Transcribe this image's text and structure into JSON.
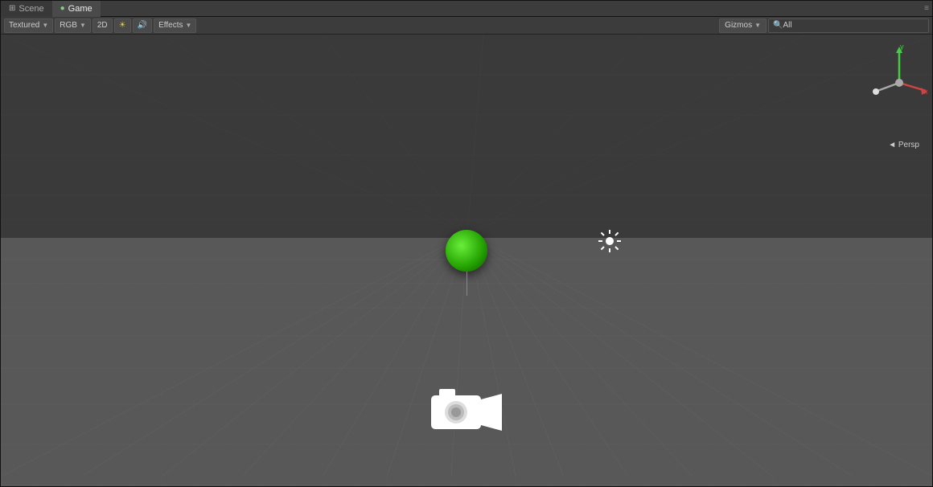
{
  "tabs": [
    {
      "id": "scene",
      "label": "Scene",
      "icon": "⊞",
      "active": false
    },
    {
      "id": "game",
      "label": "Game",
      "icon": "●",
      "active": true
    }
  ],
  "toolbar": {
    "textured_label": "Textured",
    "rgb_label": "RGB",
    "mode_2d": "2D",
    "effects_label": "Effects",
    "gizmos_label": "Gizmos",
    "search_placeholder": "All",
    "search_icon": "🔍"
  },
  "viewport": {
    "horizon_color": "#3a3a3a",
    "ground_color": "#585858",
    "grid_color": "#666666"
  },
  "gizmo": {
    "y_label": "y",
    "x_label": "x",
    "persp_label": "◄ Persp"
  },
  "objects": {
    "sphere_color": "#22cc00",
    "sun_symbol": "☀",
    "camera_symbol": "🎥"
  }
}
